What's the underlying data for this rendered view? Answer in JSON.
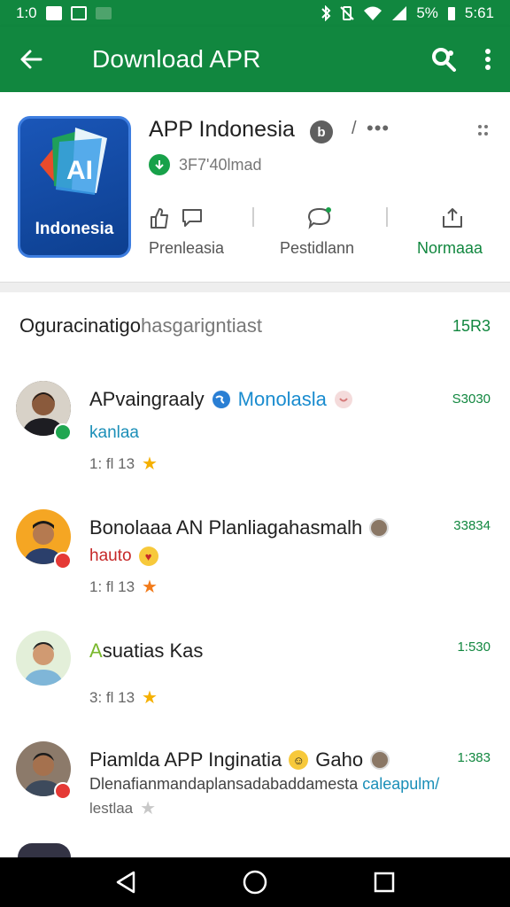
{
  "status_bar": {
    "time_left": "1:0",
    "battery": "5%",
    "time": "5:61"
  },
  "app_bar": {
    "title": "Download APR"
  },
  "app": {
    "name": "APP Indonesia",
    "icon_text": "AI",
    "icon_label": "Indonesia",
    "badge": "b",
    "slash": "/",
    "dots": "•••",
    "download_text": "3F7'40lmad",
    "actions": [
      {
        "label": "Prenleasia"
      },
      {
        "label": "Pestidlann"
      },
      {
        "label": "Normaaa"
      }
    ]
  },
  "section": {
    "title": "Oguracinatigo",
    "title_rest": " hasgarigntiast",
    "count": "15R3"
  },
  "reviews": [
    {
      "name": "APvaingraaly",
      "link": "Monolasla",
      "sub": "kanlaa",
      "meta": "1: fl 13",
      "count": "S3030"
    },
    {
      "name": "Bonolaaa AN Planliagahasmalh",
      "sub": "hauto",
      "meta": "1: fl 13",
      "count": "33834"
    },
    {
      "name": "Asuatias Kas",
      "name_prefix": "A",
      "name_rest": "suatias Kas",
      "meta": "3: fl 13",
      "count": "1:530"
    },
    {
      "name": "Piamlda APP Inginatia",
      "name_after": "Gaho",
      "body": "Dlenafianmandaplansadabaddamesta",
      "body_link": "caleapulm/",
      "meta": "lestlaa",
      "count": "1:383"
    }
  ],
  "colors": {
    "primary": "#11873f",
    "link": "#1a8ccf",
    "star": "#f5b000",
    "star_orange": "#f27b1a"
  },
  "icons": [
    "arrow-back-icon",
    "search-icon",
    "more-vert-icon",
    "download-icon",
    "thumb-up-icon",
    "chat-icon",
    "share-icon",
    "star-icon",
    "back-nav-icon",
    "home-nav-icon",
    "recents-nav-icon"
  ]
}
